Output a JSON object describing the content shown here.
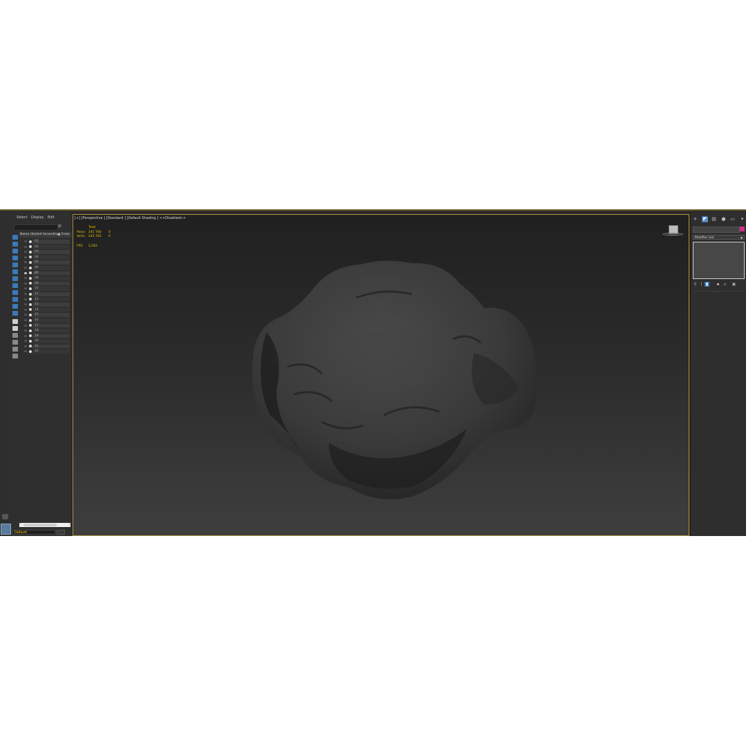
{
  "explorer": {
    "menu": [
      "Select",
      "Display",
      "Edit"
    ],
    "column_name": "Name (Sorted Ascending)",
    "column_frozen": "▲ Froze",
    "rows": [
      "01",
      "02",
      "03",
      "04",
      "05",
      "06",
      "07",
      "08",
      "09",
      "10",
      "11",
      "12",
      "13",
      "14",
      "15",
      "16",
      "17",
      "18",
      "19",
      "20",
      "21",
      "22"
    ],
    "active_row": "07",
    "layer": "Default"
  },
  "viewport": {
    "label": "[+] [Perspective ] [Standard ] [Default Shading ]  <<Disabled>>",
    "stats": {
      "total_label": "Total",
      "polys_label": "Polys:",
      "polys_value": "245 760",
      "polys_sel": "0",
      "verts_label": "Verts:",
      "verts_value": "245 762",
      "verts_sel": "0",
      "fps_label": "FPS:",
      "fps_value": "2,283"
    }
  },
  "command_panel": {
    "tabs": [
      "create-icon",
      "modify-icon",
      "hierarchy-icon",
      "motion-icon",
      "display-icon",
      "utilities-icon"
    ],
    "modifier_list": "Modifier List"
  },
  "colors": {
    "stats_text": "#e8c000",
    "viewport_border": "#b09a3a",
    "accent": "#3d78b8",
    "object_color": "#d0308a"
  }
}
